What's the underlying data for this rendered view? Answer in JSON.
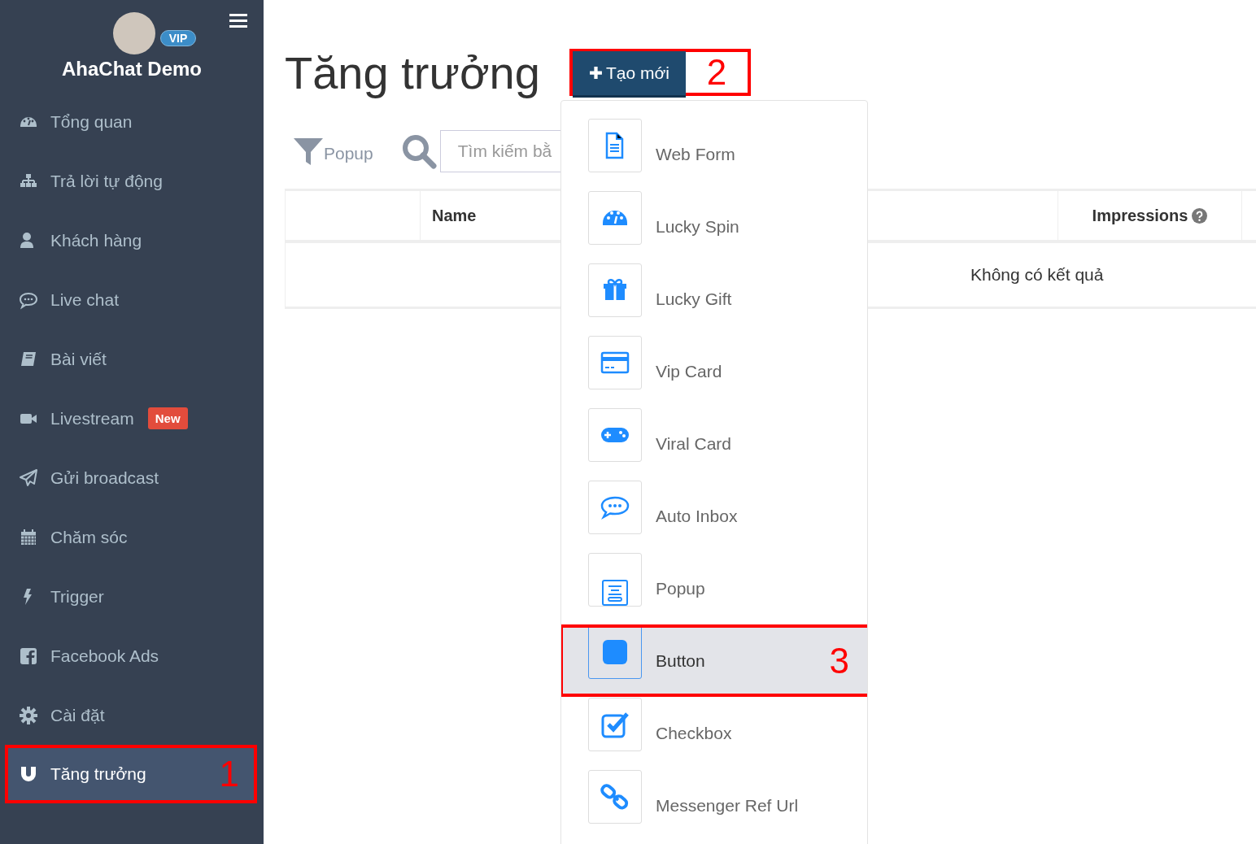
{
  "sidebar": {
    "account": {
      "name": "AhaChat Demo",
      "badge": "VIP"
    },
    "items": [
      {
        "label": "Tổng quan",
        "selected": false
      },
      {
        "label": "Trả lời tự động",
        "selected": false
      },
      {
        "label": "Khách hàng",
        "selected": false
      },
      {
        "label": "Live chat",
        "selected": false
      },
      {
        "label": "Bài viết",
        "selected": false
      },
      {
        "label": "Livestream",
        "badge": "New",
        "selected": false
      },
      {
        "label": "Gửi broadcast",
        "selected": false
      },
      {
        "label": "Chăm sóc",
        "selected": false
      },
      {
        "label": "Trigger",
        "selected": false
      },
      {
        "label": "Facebook Ads",
        "selected": false
      },
      {
        "label": "Cài đặt",
        "selected": false
      },
      {
        "label": "Tăng trưởng",
        "selected": true,
        "callout": "1"
      }
    ]
  },
  "page": {
    "title": "Tăng trưởng",
    "create_button": {
      "label": "Tạo mới",
      "callout": "2"
    }
  },
  "filter": {
    "label": "Popup"
  },
  "search": {
    "placeholder": "Tìm kiếm bằ"
  },
  "table": {
    "columns": [
      "Name",
      "Impressions"
    ],
    "empty_text": "Không có kết quả"
  },
  "dropdown": {
    "items": [
      {
        "label": "Web Form",
        "selected": false
      },
      {
        "label": "Lucky Spin",
        "selected": false
      },
      {
        "label": "Lucky Gift",
        "selected": false
      },
      {
        "label": "Vip Card",
        "selected": false
      },
      {
        "label": "Viral Card",
        "selected": false
      },
      {
        "label": "Auto Inbox",
        "selected": false
      },
      {
        "label": "Popup",
        "selected": false
      },
      {
        "label": "Button",
        "selected": true,
        "callout": "3"
      },
      {
        "label": "Checkbox",
        "selected": false
      },
      {
        "label": "Messenger Ref Url",
        "selected": false
      }
    ]
  }
}
